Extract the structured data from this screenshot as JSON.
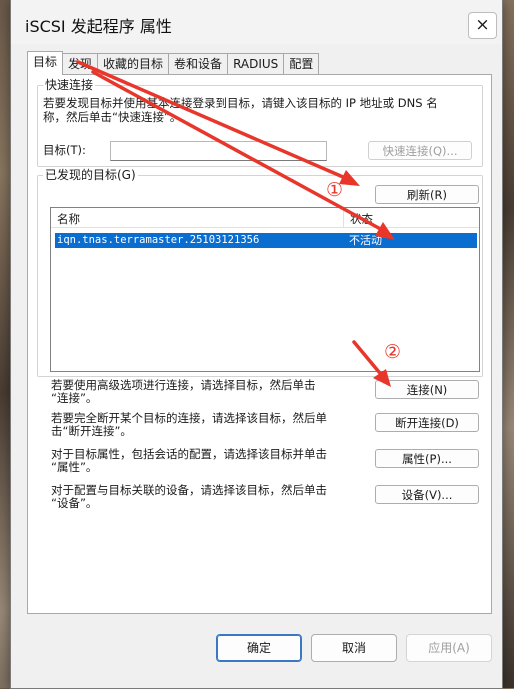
{
  "window": {
    "title": "iSCSI 发起程序 属性",
    "close_icon": "×"
  },
  "tabs": [
    {
      "label": "目标"
    },
    {
      "label": "发现"
    },
    {
      "label": "收藏的目标"
    },
    {
      "label": "卷和设备"
    },
    {
      "label": "RADIUS"
    },
    {
      "label": "配置"
    }
  ],
  "quick_connect": {
    "group_label": "快速连接",
    "description_line1": "若要发现目标并使用基本连接登录到目标，请键入该目标的 IP 地址或 DNS 名",
    "description_line2": "称，然后单击“快速连接”。",
    "target_label": "目标(T):",
    "target_value": "",
    "quick_connect_button": "快速连接(Q)..."
  },
  "discovered": {
    "group_label": "已发现的目标(G)",
    "refresh_button": "刷新(R)",
    "columns": [
      "名称",
      "状态"
    ],
    "rows": [
      {
        "name": "iqn.tnas.terramaster.25103121356",
        "status": "不活动"
      }
    ]
  },
  "actions": [
    {
      "text_line1": "若要使用高级选项进行连接，请选择目标，然后单击",
      "text_line2": "“连接”。",
      "button": "连接(N)"
    },
    {
      "text_line1": "若要完全断开某个目标的连接，请选择该目标，然后单",
      "text_line2": "击“断开连接”。",
      "button": "断开连接(D)"
    },
    {
      "text_line1": "对于目标属性，包括会话的配置，请选择该目标并单击",
      "text_line2": "“属性”。",
      "button": "属性(P)..."
    },
    {
      "text_line1": "对于配置与目标关联的设备，请选择该目标，然后单击",
      "text_line2": "“设备”。",
      "button": "设备(V)..."
    }
  ],
  "footer": {
    "ok": "确定",
    "cancel": "取消",
    "apply": "应用(A)"
  },
  "annotations": {
    "step1": "①",
    "step2": "②",
    "color": "#e8362a"
  }
}
